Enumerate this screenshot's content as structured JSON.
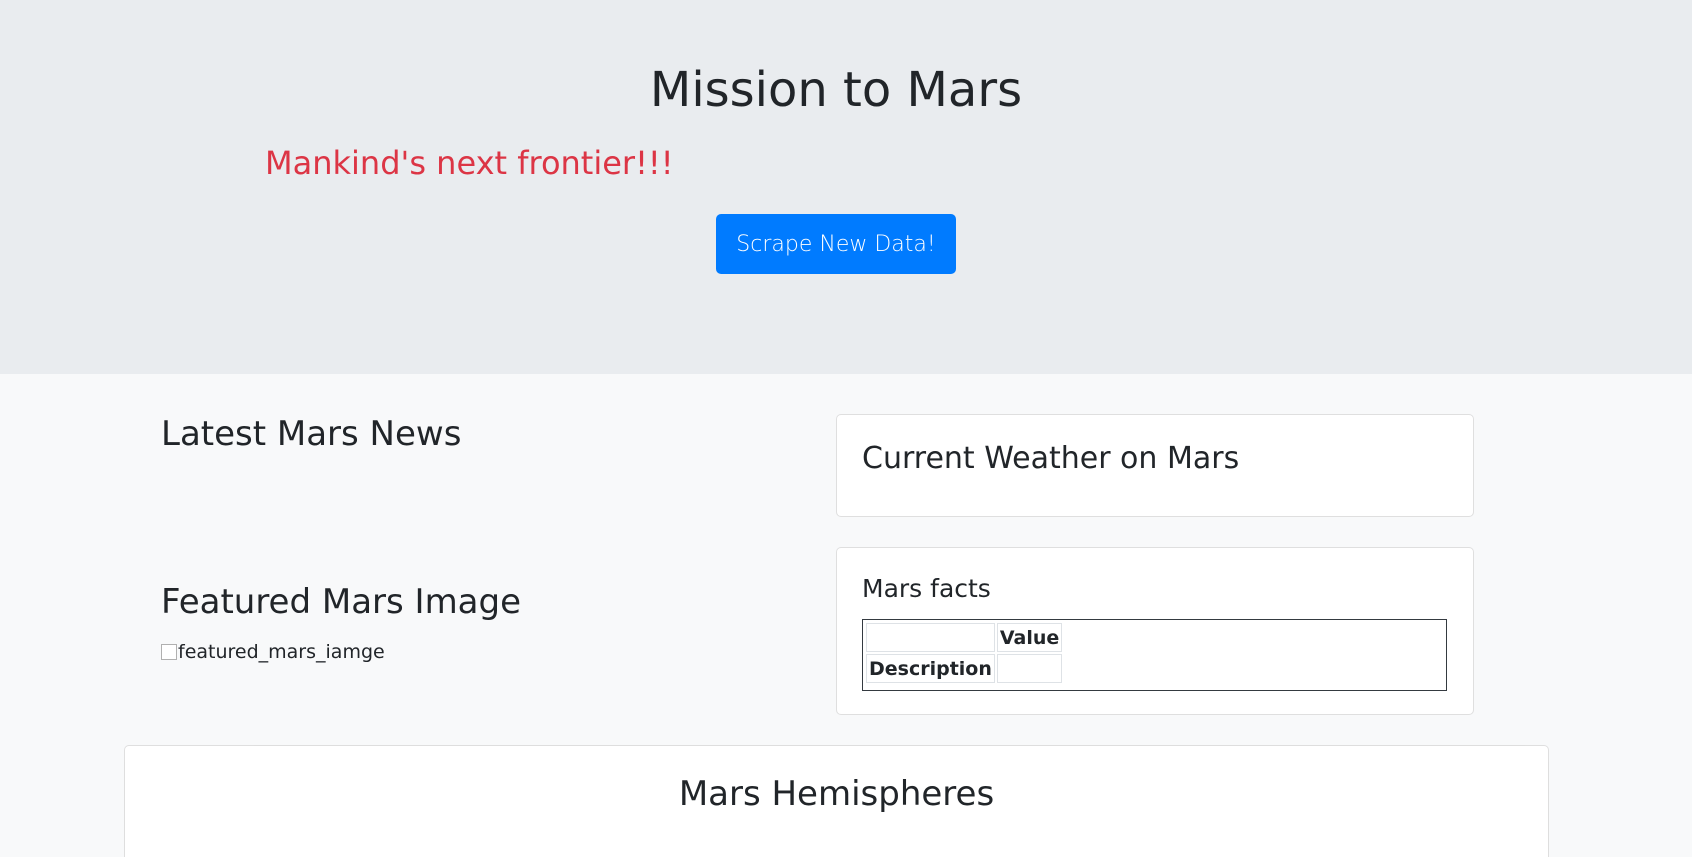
{
  "header": {
    "title": "Mission to Mars",
    "subtitle": "Mankind's next frontier!!!",
    "scrape_button_label": "Scrape New Data!"
  },
  "news": {
    "heading": "Latest Mars News"
  },
  "featured_image": {
    "heading": "Featured Mars Image",
    "alt_text": "featured_mars_iamge"
  },
  "weather": {
    "heading": "Current Weather on Mars"
  },
  "facts": {
    "heading": "Mars facts",
    "columns": [
      "",
      "Value"
    ],
    "rows": [
      {
        "label": "Description",
        "value": ""
      }
    ]
  },
  "hemispheres": {
    "heading": "Mars Hemispheres"
  },
  "colors": {
    "accent": "#dc3545",
    "button": "#007bff",
    "jumbotron": "#e9ecef",
    "page_bg": "#f8f9fa"
  }
}
